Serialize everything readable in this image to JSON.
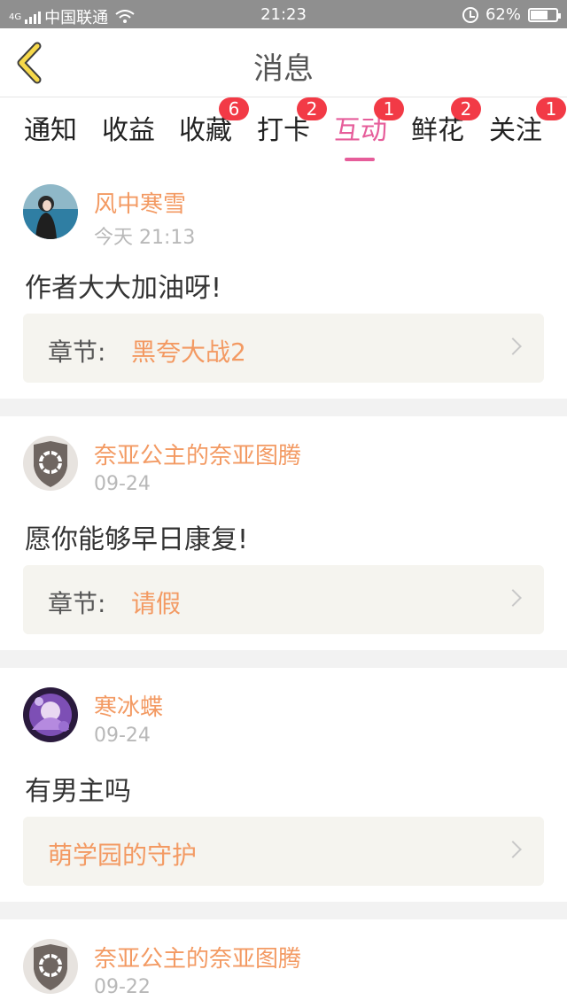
{
  "status_bar": {
    "network_tag": "4G",
    "carrier": "中国联通",
    "time": "21:23",
    "battery": "62%",
    "battery_level": 0.62,
    "icons": [
      "signal-icon",
      "wifi-icon",
      "alarm-icon",
      "battery-icon"
    ]
  },
  "nav": {
    "back_icon": "back-chevron-icon",
    "title": "消息"
  },
  "tabs": [
    {
      "label": "通知",
      "badge": ""
    },
    {
      "label": "收益",
      "badge": ""
    },
    {
      "label": "收藏",
      "badge": "6"
    },
    {
      "label": "打卡",
      "badge": "2"
    },
    {
      "label": "互动",
      "badge": "1",
      "active": true
    },
    {
      "label": "鲜花",
      "badge": "2"
    },
    {
      "label": "关注",
      "badge": "1"
    }
  ],
  "colors": {
    "accent": "#e65d9a",
    "username": "#f39a63",
    "badge": "#f23a46",
    "separator": "#f2f2f2"
  },
  "messages": [
    {
      "user": "风中寒雪",
      "time": "今天 21:13",
      "text": "作者大大加油呀!",
      "chapter_label": "章节:",
      "chapter_name": "黑夸大战2"
    },
    {
      "user": "奈亚公主的奈亚图腾",
      "time": "09-24",
      "text": "愿你能够早日康复!",
      "chapter_label": "章节:",
      "chapter_name": "请假"
    },
    {
      "user": "寒冰蝶",
      "time": "09-24",
      "text": "有男主吗",
      "chapter_label": "",
      "chapter_name": "萌学园的守护"
    },
    {
      "user": "奈亚公主的奈亚图腾",
      "time": "09-22"
    }
  ]
}
